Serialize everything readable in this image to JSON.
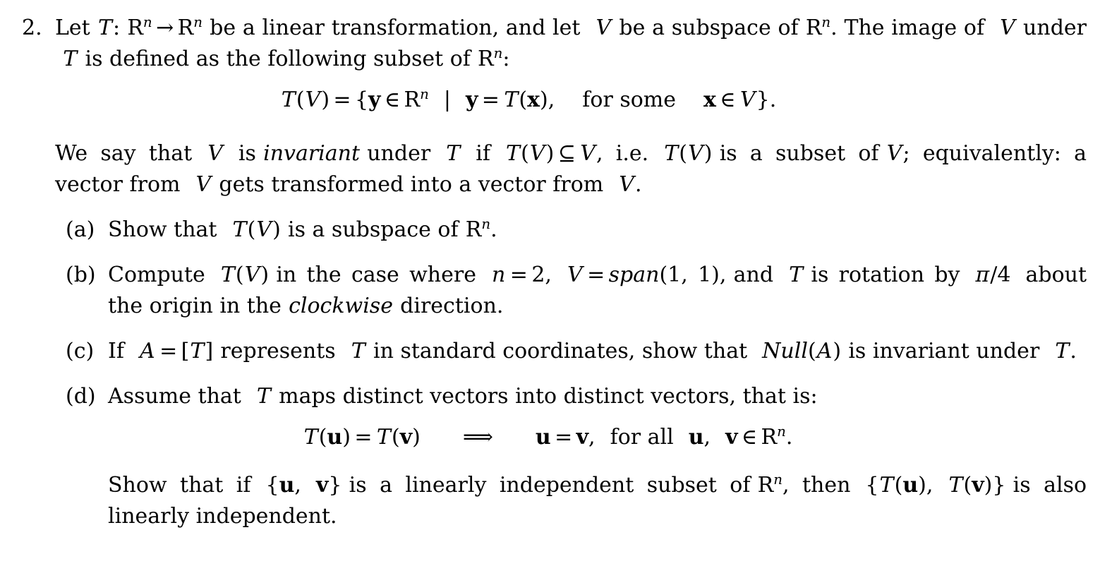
{
  "document": {
    "background_color": "#ffffff",
    "text_color": "#000000",
    "problem_number": "2.",
    "intro": {
      "s1": "Let",
      "var_T": "T",
      "colon": ":",
      "R1": "R",
      "sup_n1": "n",
      "arrow": "→",
      "R2": "R",
      "sup_n2": "n",
      "s2": "be a linear transformation, and let",
      "var_V": "V",
      "s3": "be a subspace of",
      "R3": "R",
      "sup_n3": "n",
      "s4": ". The image of",
      "var_V2": "V",
      "s5": "under",
      "var_T2": "T",
      "s6": "is defined as the following subset of",
      "R4": "R",
      "sup_n4": "n",
      "s7": ":"
    },
    "equation1": {
      "lhs_T": "T",
      "lhs_paren_open": "(",
      "lhs_V": "V",
      "lhs_paren_close": ")",
      "equals": "=",
      "brace_open": "{",
      "y1": "y",
      "elem1": "∈",
      "R": "R",
      "sup_n": "n",
      "mid": "|",
      "y2": "y",
      "equals2": "=",
      "T2": "T",
      "paren_open2": "(",
      "x1": "x",
      "paren_close2": ")",
      "comma": ",",
      "for_some": "for some",
      "x2": "x",
      "elem2": "∈",
      "V2": "V",
      "brace_close": "}",
      "period": "."
    },
    "definition": {
      "d1": "We say that",
      "var_V": "V",
      "d2": "is",
      "invariant": "invariant",
      "d3": "under",
      "var_T": "T",
      "d4": "if",
      "T_V": "T",
      "paren_open": "(",
      "V_in": "V",
      "paren_close": ")",
      "subseteq": "⊆",
      "V_rhs": "V",
      "d5": ", i.e.",
      "T_V2": "T",
      "paren_open2": "(",
      "V_in2": "V",
      "paren_close2": ")",
      "d6": "is a subset of",
      "V_rhs2": "V",
      "d7": "; equivalently: a vector from",
      "V_rhs3": "V",
      "d8": "gets transformed into a vector from",
      "V_rhs4": "V",
      "d9": "."
    },
    "subitems": [
      {
        "label": "(a)",
        "name": "subitem-a"
      },
      {
        "label": "(b)",
        "name": "subitem-b"
      },
      {
        "label": "(c)",
        "name": "subitem-c"
      },
      {
        "label": "(d)",
        "name": "subitem-d"
      }
    ],
    "part_a": {
      "a1": "Show that",
      "T": "T",
      "paren_open": "(",
      "V": "V",
      "paren_close": ")",
      "a2": "is a subspace of",
      "R": "R",
      "sup_n": "n",
      "a3": "."
    },
    "part_b": {
      "b1": "Compute",
      "T": "T",
      "paren_open": "(",
      "V": "V",
      "paren_close": ")",
      "b2": "in the case where",
      "n": "n",
      "eq1": "=",
      "two": "2",
      "comma1": ",",
      "V2": "V",
      "eq2": "=",
      "span": "span",
      "span_args": "(1, 1)",
      "comma2": ",",
      "b3": "and",
      "T2": "T",
      "b4": "is rotation by",
      "pi": "π",
      "slash4": "/4",
      "b5": "about the origin in the",
      "clockwise": "clockwise",
      "b6": "direction."
    },
    "part_c": {
      "c1": "If",
      "A": "A",
      "eq": "=",
      "bracket_open": "[",
      "T": "T",
      "bracket_close": "]",
      "c2": "represents",
      "T2": "T",
      "c3": "in standard coordinates, show that",
      "null": "Null",
      "null_open": "(",
      "null_A": "A",
      "null_close": ")",
      "c4": "is invariant under",
      "T3": "T",
      "c5": "."
    },
    "part_d": {
      "d1": "Assume that",
      "T": "T",
      "d2": "maps distinct vectors into distinct vectors, that is:"
    },
    "equation2": {
      "T1": "T",
      "open1": "(",
      "u1": "u",
      "close1": ")",
      "equals1": "=",
      "T2": "T",
      "open2": "(",
      "v1": "v",
      "close2": ")",
      "implies": "⟹",
      "u2": "u",
      "equals2": "=",
      "v2": "v",
      "comma": ",",
      "for_all": "for all",
      "u3": "u",
      "comma2": ",",
      "v3": "v",
      "elem": "∈",
      "R": "R",
      "sup_n": "n",
      "period": "."
    },
    "part_d_tail": {
      "t1": "Show that if",
      "brace_open": "{",
      "u": "u",
      "comma": ",",
      "v": "v",
      "brace_close": "}",
      "t2": "is a linearly independent subset of",
      "R": "R",
      "sup_n": "n",
      "t3": ", then",
      "brace_open2": "{",
      "T1": "T",
      "open1": "(",
      "u2": "u",
      "close1": ")",
      "comma2": ",",
      "T2": "T",
      "open2": "(",
      "v2": "v",
      "close2": ")",
      "brace_close2": "}",
      "t4": "is also linearly independent."
    }
  }
}
